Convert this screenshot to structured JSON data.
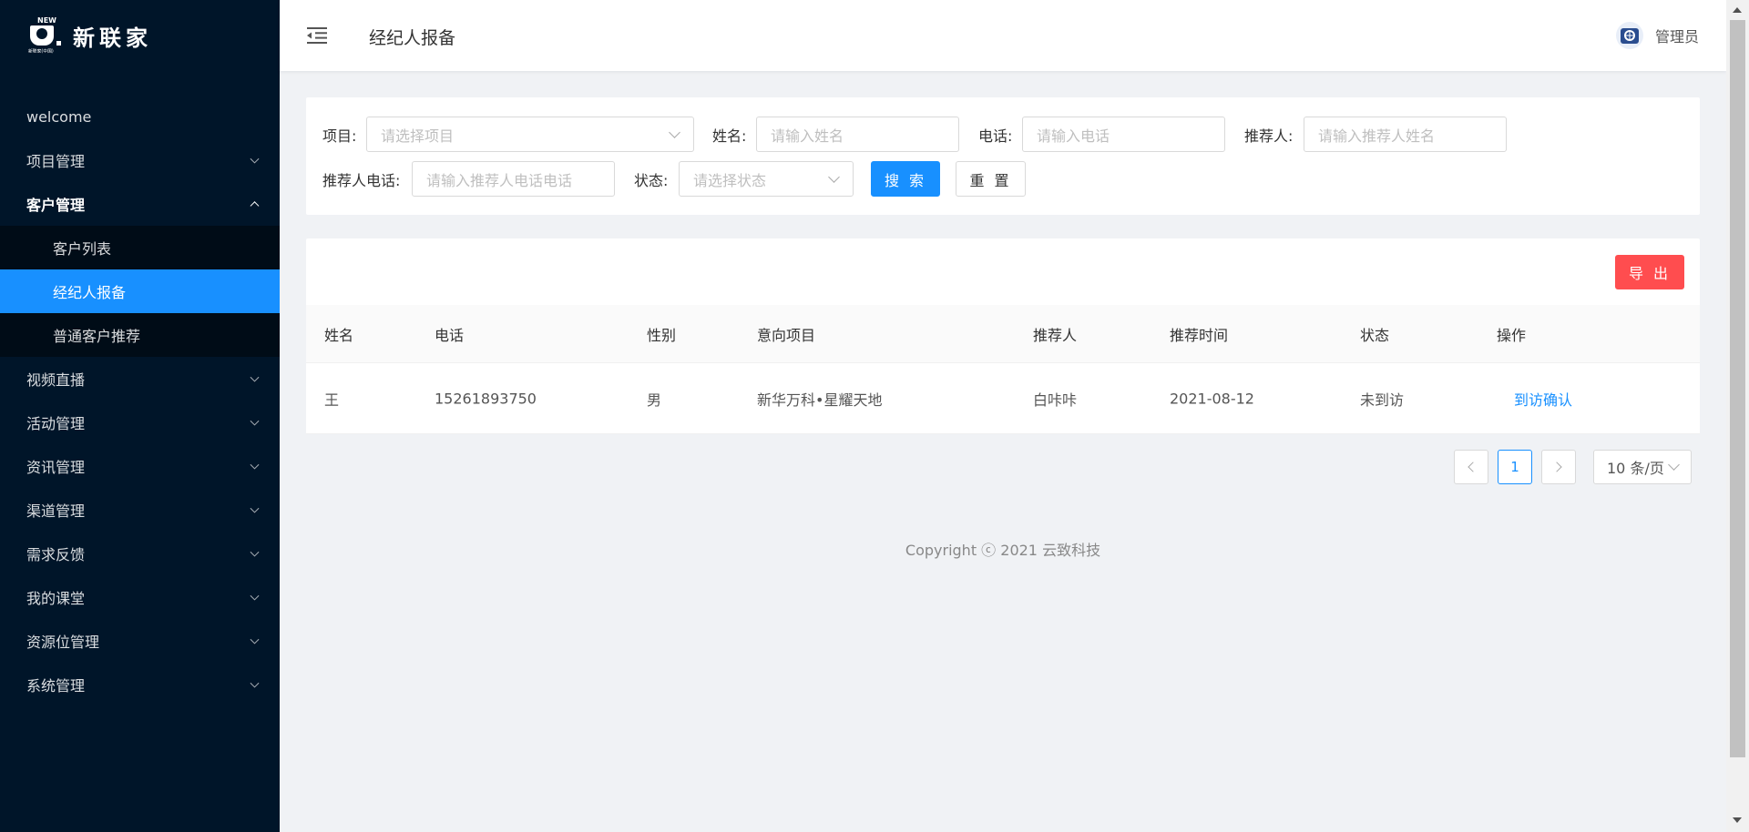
{
  "app": {
    "logo_text": "新联家",
    "logo_badge": "NEW",
    "logo_sub": "新联家(中国)"
  },
  "sidebar": {
    "items": [
      {
        "label": "welcome"
      },
      {
        "label": "项目管理"
      },
      {
        "label": "客户管理"
      },
      {
        "label": "客户列表"
      },
      {
        "label": "经纪人报备"
      },
      {
        "label": "普通客户推荐"
      },
      {
        "label": "视频直播"
      },
      {
        "label": "活动管理"
      },
      {
        "label": "资讯管理"
      },
      {
        "label": "渠道管理"
      },
      {
        "label": "需求反馈"
      },
      {
        "label": "我的课堂"
      },
      {
        "label": "资源位管理"
      },
      {
        "label": "系统管理"
      }
    ]
  },
  "header": {
    "title": "经纪人报备",
    "user": "管理员"
  },
  "search": {
    "project_label": "项目:",
    "project_placeholder": "请选择项目",
    "name_label": "姓名:",
    "name_placeholder": "请输入姓名",
    "phone_label": "电话:",
    "phone_placeholder": "请输入电话",
    "referrer_label": "推荐人:",
    "referrer_placeholder": "请输入推荐人姓名",
    "referrer_phone_label": "推荐人电话:",
    "referrer_phone_placeholder": "请输入推荐人电话电话",
    "status_label": "状态:",
    "status_placeholder": "请选择状态",
    "search_button": "搜 索",
    "reset_button": "重 置"
  },
  "table": {
    "export_button": "导 出",
    "columns": [
      "姓名",
      "电话",
      "性别",
      "意向项目",
      "推荐人",
      "推荐时间",
      "状态",
      "操作"
    ],
    "rows": [
      {
        "name": "王",
        "phone": "15261893750",
        "gender": "男",
        "project": "新华万科•星耀天地",
        "referrer": "白咔咔",
        "date": "2021-08-12",
        "status": "未到访",
        "action": "到访确认"
      }
    ]
  },
  "pagination": {
    "current_page": "1",
    "page_size": "10 条/页"
  },
  "footer": {
    "copyright": "Copyright ⓒ 2021 云致科技"
  },
  "colors": {
    "sidebar_bg": "#001529",
    "primary": "#1890ff",
    "danger": "#ff4d4f"
  }
}
